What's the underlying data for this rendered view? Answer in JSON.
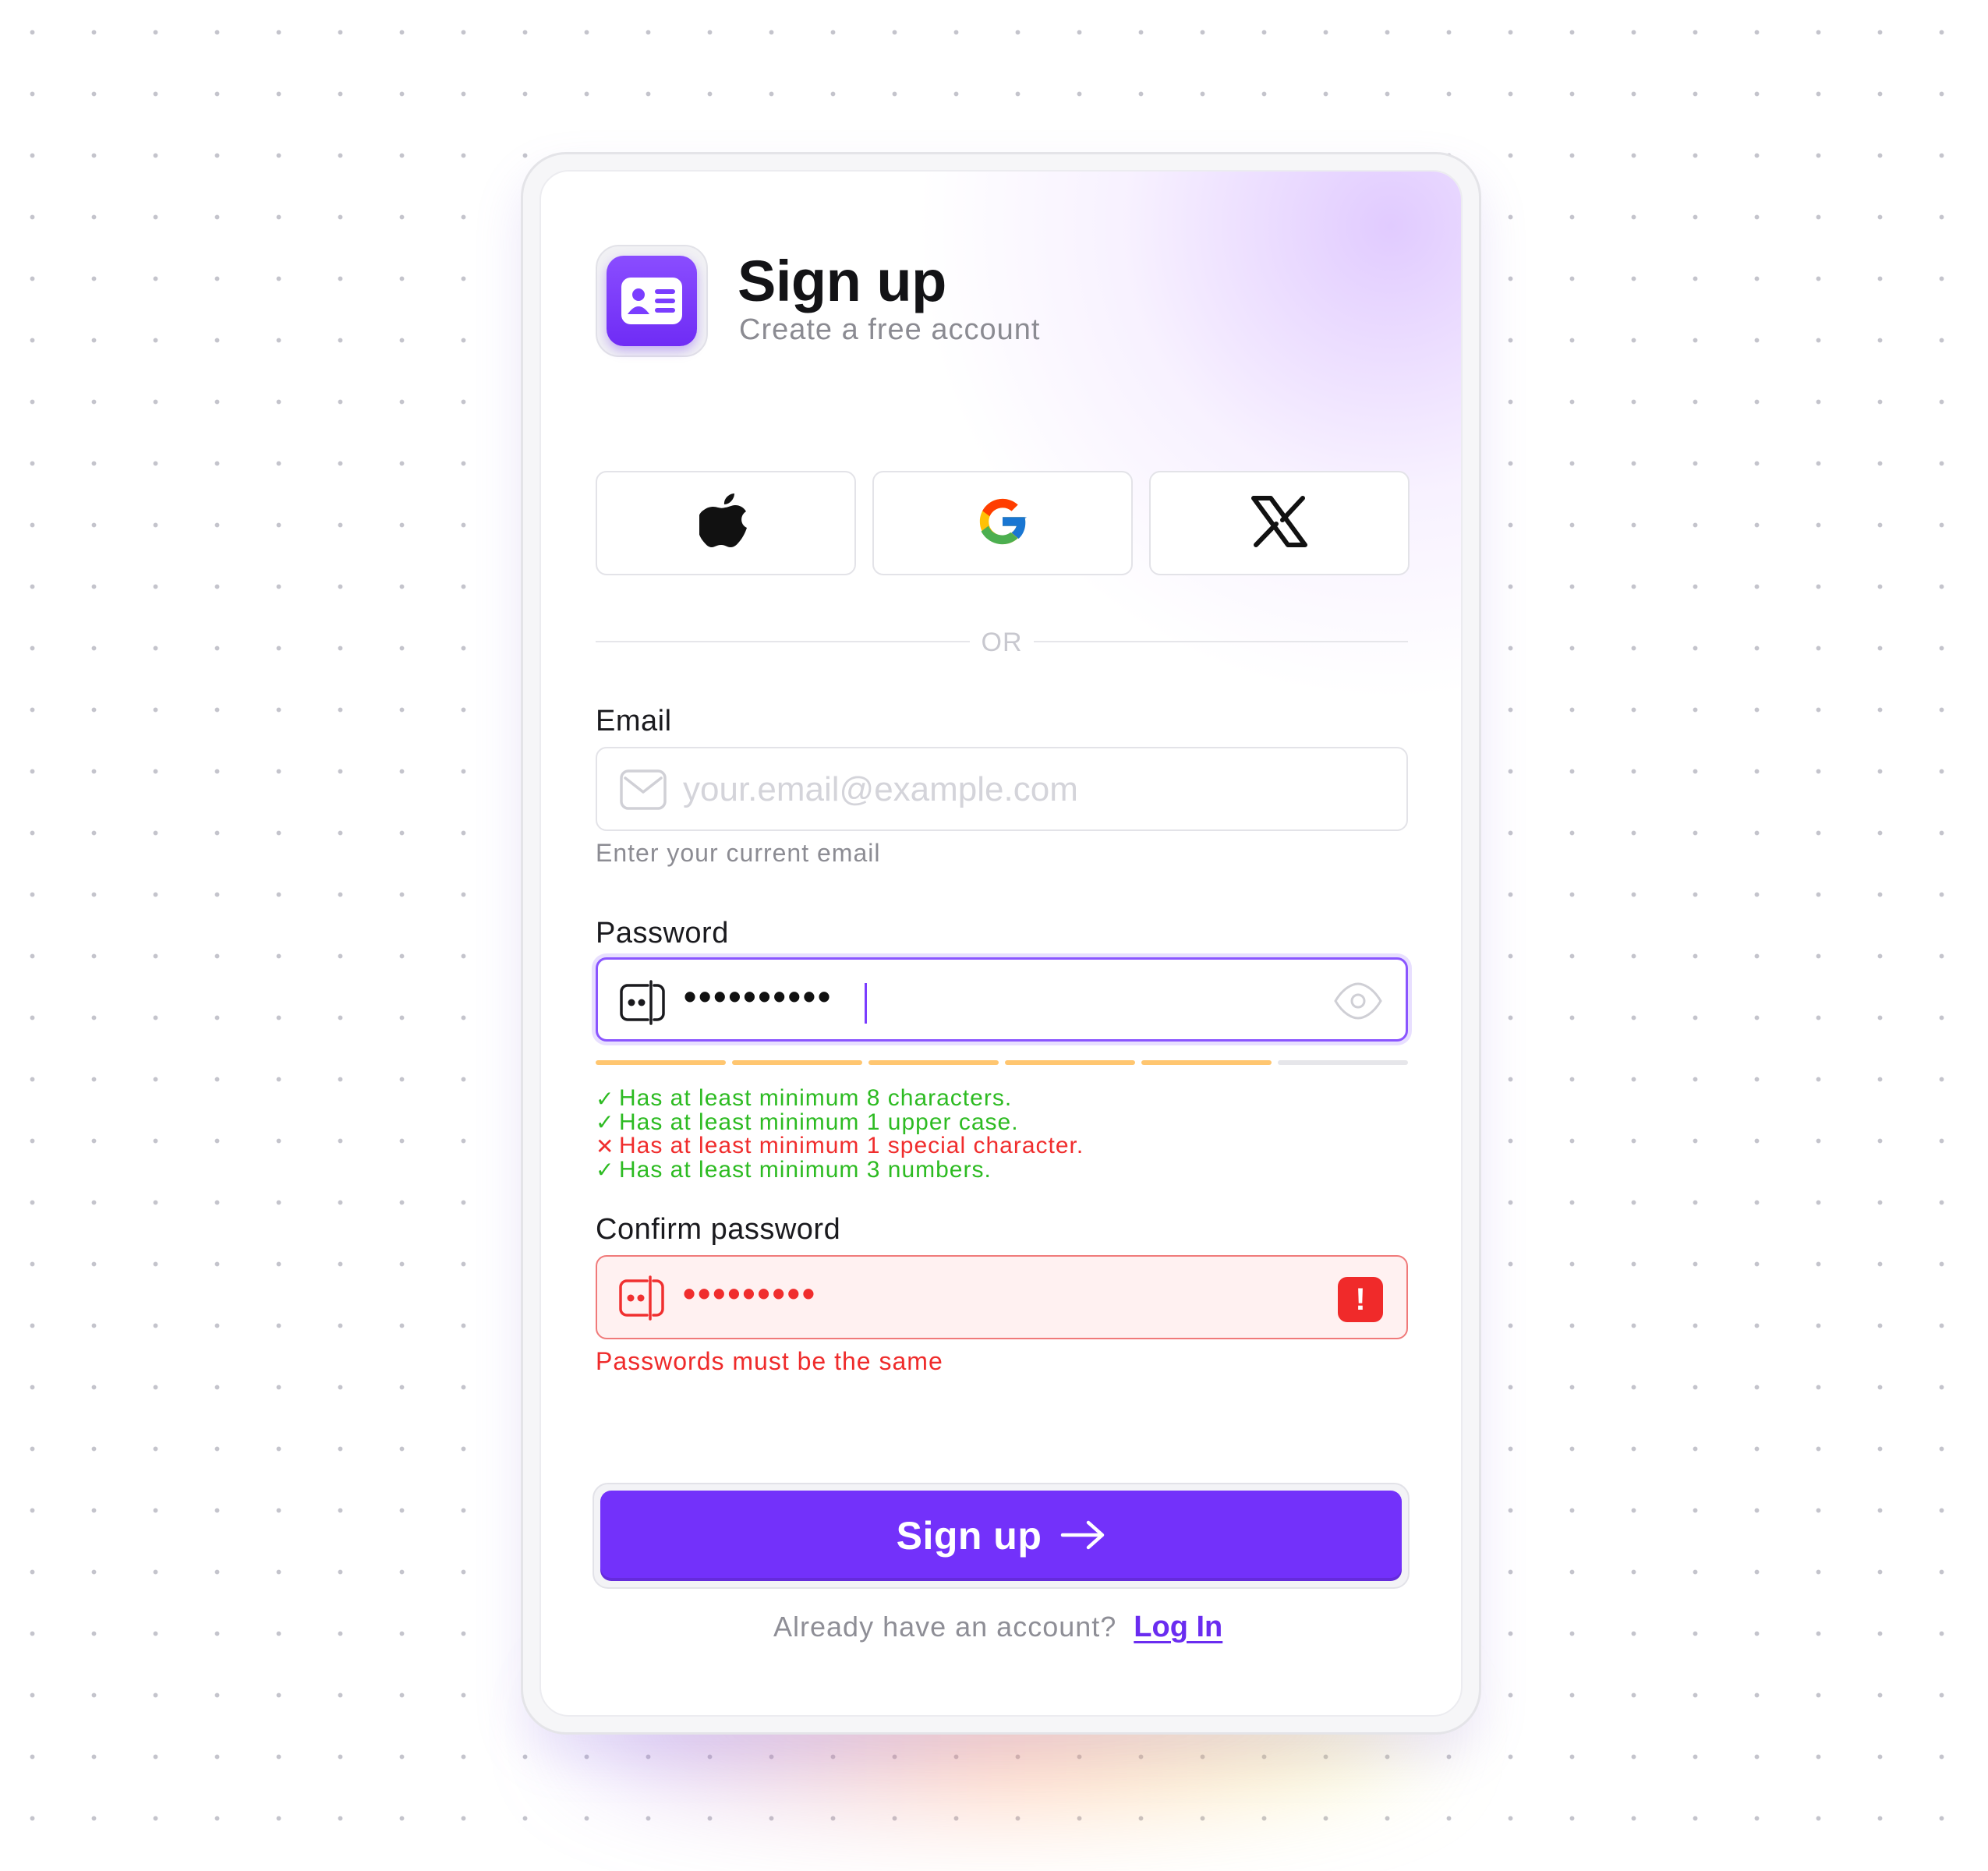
{
  "header": {
    "title": "Sign up",
    "subtitle": "Create a free account",
    "app_icon": "id-card-icon"
  },
  "social": [
    {
      "name": "apple",
      "icon": "apple-icon"
    },
    {
      "name": "google",
      "icon": "google-icon"
    },
    {
      "name": "x",
      "icon": "x-icon"
    }
  ],
  "divider": {
    "label": "OR"
  },
  "email": {
    "label": "Email",
    "placeholder": "your.email@example.com",
    "value": "",
    "hint": "Enter your current email"
  },
  "password": {
    "label": "Password",
    "masked_value": "••••••••••",
    "strength_filled": 5,
    "strength_total": 6,
    "requirements": [
      {
        "text": "Has at least minimum 8 characters.",
        "met": true
      },
      {
        "text": "Has at least minimum 1 upper case.",
        "met": true
      },
      {
        "text": "Has at least minimum 1 special character.",
        "met": false
      },
      {
        "text": "Has at least minimum 3 numbers.",
        "met": true
      }
    ]
  },
  "confirm": {
    "label": "Confirm password",
    "masked_value": "•••••••••",
    "error_badge": "!",
    "error": "Passwords must be the same"
  },
  "submit": {
    "label": "Sign up"
  },
  "footer": {
    "prompt": "Already have an account?",
    "link": "Log In"
  },
  "colors": {
    "accent": "#7331fa",
    "success": "#2dbb22",
    "error": "#f02d2d",
    "strength": "#ffc670"
  }
}
